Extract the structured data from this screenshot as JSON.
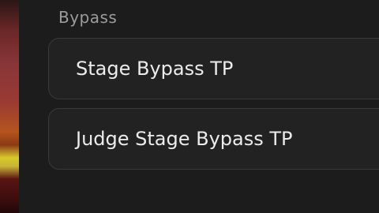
{
  "section": {
    "title": "Bypass"
  },
  "options": [
    {
      "label": "Stage Bypass TP"
    },
    {
      "label": "Judge Stage Bypass TP"
    }
  ]
}
